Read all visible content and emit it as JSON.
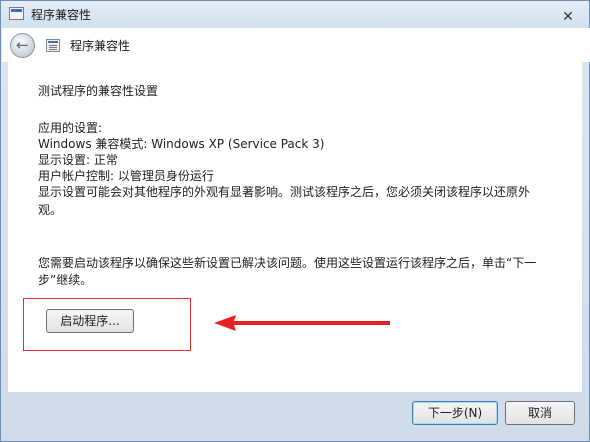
{
  "window": {
    "title": "程序兼容性",
    "close_label": "✕"
  },
  "nav": {
    "back_label": "←",
    "title": "程序兼容性"
  },
  "content": {
    "heading": "测试程序的兼容性设置",
    "settings_label": "应用的设置:",
    "compat_mode": "Windows 兼容模式: Windows XP (Service Pack 3)",
    "display_setting": "显示设置: 正常",
    "uac_setting": "用户帐户控制: 以管理员身份运行",
    "display_note_line1": "显示设置可能会对其他程序的外观有显著影响。测试该程序之后，您必须关闭该程序以还原外",
    "display_note_line2": "观。",
    "instruction_line1": "您需要启动该程序以确保这些新设置已解决该问题。使用这些设置运行该程序之后，单击“下一",
    "instruction_line2": "步”继续。",
    "start_button_label": "启动程序..."
  },
  "footer": {
    "next_label": "下一步(N)",
    "cancel_label": "取消"
  },
  "colors": {
    "highlight": "#e03030",
    "arrow": "#e82020"
  }
}
